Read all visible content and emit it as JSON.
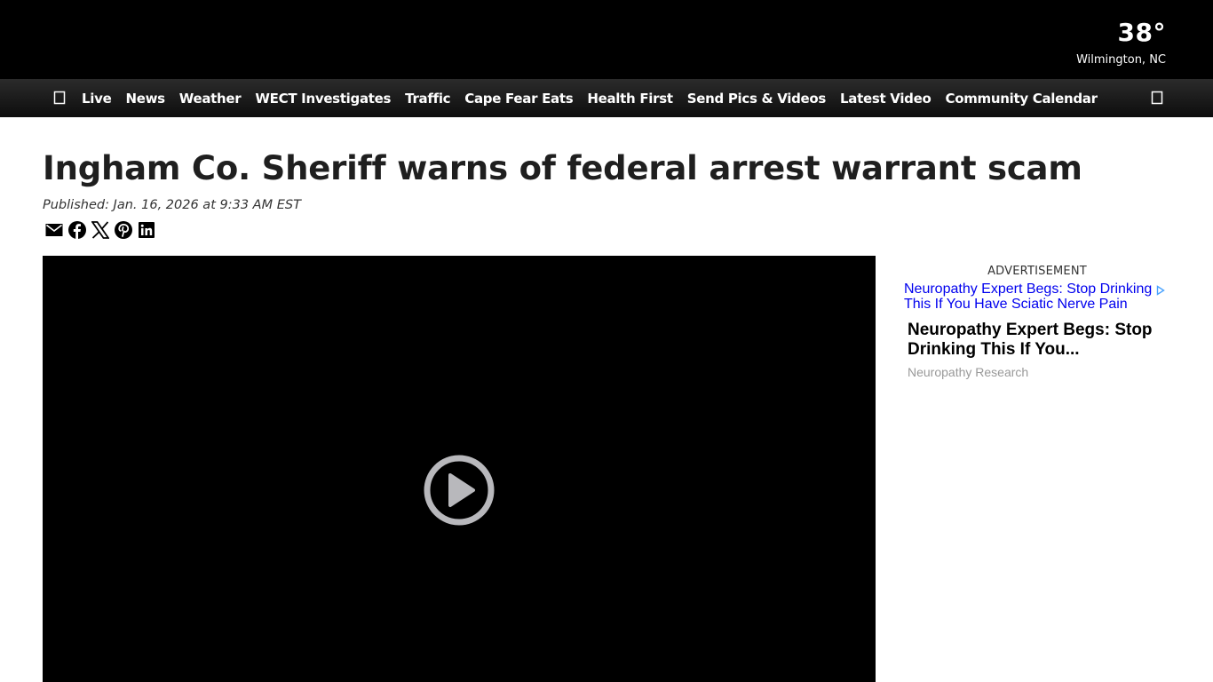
{
  "header": {
    "weather": {
      "temperature": "38°",
      "location": "Wilmington, NC"
    }
  },
  "nav": {
    "menu_icon": "hamburger-icon",
    "search_icon": "search-icon",
    "items": [
      {
        "label": "Live"
      },
      {
        "label": "News"
      },
      {
        "label": "Weather"
      },
      {
        "label": "WECT Investigates"
      },
      {
        "label": "Traffic"
      },
      {
        "label": "Cape Fear Eats"
      },
      {
        "label": "Health First"
      },
      {
        "label": "Send Pics & Videos"
      },
      {
        "label": "Latest Video"
      },
      {
        "label": "Community Calendar"
      }
    ]
  },
  "article": {
    "headline": "Ingham Co. Sheriff warns of federal arrest warrant scam",
    "published": "Published: Jan. 16, 2026 at 9:33 AM EST",
    "share_icons": [
      "email-icon",
      "facebook-icon",
      "x-icon",
      "pinterest-icon",
      "linkedin-icon"
    ]
  },
  "video": {
    "play_icon": "play-icon"
  },
  "ad": {
    "label": "ADVERTISEMENT",
    "image_alt": "Neuropathy Expert Begs: Stop Drinking This If You Have Sciatic Nerve Pain",
    "title": "Neuropathy Expert Begs: Stop Drinking This If You...",
    "source": "Neuropathy Research"
  },
  "colors": {
    "header_bg": "#000000",
    "nav_bg": "#1a1a1a",
    "headline": "#1f1f1f",
    "ad_link": "#0000ee",
    "ad_source": "#999999"
  }
}
